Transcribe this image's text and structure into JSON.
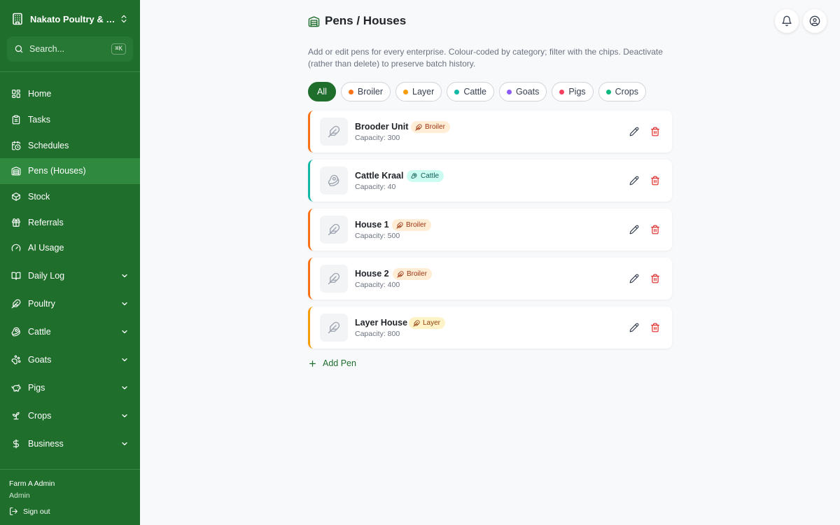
{
  "sidebar": {
    "farm_name": "Nakato Poultry & Dairy",
    "search": {
      "placeholder": "Search...",
      "shortcut": "⌘K"
    },
    "items": [
      {
        "label": "Home",
        "icon": "home-icon"
      },
      {
        "label": "Tasks",
        "icon": "clipboard-icon"
      },
      {
        "label": "Schedules",
        "icon": "calendar-clock-icon"
      },
      {
        "label": "Pens (Houses)",
        "icon": "warehouse-icon",
        "active": true
      },
      {
        "label": "Stock",
        "icon": "package-icon"
      },
      {
        "label": "Referrals",
        "icon": "gift-icon"
      },
      {
        "label": "AI Usage",
        "icon": "gauge-icon"
      }
    ],
    "groups": [
      {
        "label": "Daily Log",
        "icon": "book-icon"
      },
      {
        "label": "Poultry",
        "icon": "feather-icon"
      },
      {
        "label": "Cattle",
        "icon": "beef-icon"
      },
      {
        "label": "Goats",
        "icon": "paw-icon"
      },
      {
        "label": "Pigs",
        "icon": "piggy-icon"
      },
      {
        "label": "Crops",
        "icon": "sprout-icon"
      },
      {
        "label": "Business",
        "icon": "dollar-icon"
      }
    ],
    "user": {
      "name": "Farm A Admin",
      "role": "Admin",
      "signout_label": "Sign out"
    }
  },
  "header": {
    "title": "Pens / Houses",
    "description": "Add or edit pens for every enterprise. Colour-coded by category; filter with the chips. Deactivate (rather than delete) to preserve batch history."
  },
  "filters": [
    {
      "label": "All",
      "active": true,
      "color": ""
    },
    {
      "label": "Broiler",
      "active": false,
      "color": "#f97316"
    },
    {
      "label": "Layer",
      "active": false,
      "color": "#f59e0b"
    },
    {
      "label": "Cattle",
      "active": false,
      "color": "#14b8a6"
    },
    {
      "label": "Goats",
      "active": false,
      "color": "#8b5cf6"
    },
    {
      "label": "Pigs",
      "active": false,
      "color": "#f43f5e"
    },
    {
      "label": "Crops",
      "active": false,
      "color": "#10b981"
    }
  ],
  "pens": [
    {
      "name": "Brooder Unit",
      "capacity": "Capacity: 300",
      "category": "Broiler",
      "icon": "feather-icon",
      "accent": "#f97316",
      "badge_bg": "#ffedd5",
      "badge_fg": "#9a3412"
    },
    {
      "name": "Cattle Kraal",
      "capacity": "Capacity: 40",
      "category": "Cattle",
      "icon": "beef-icon",
      "accent": "#14b8a6",
      "badge_bg": "#ccfbf1",
      "badge_fg": "#115e59"
    },
    {
      "name": "House 1",
      "capacity": "Capacity: 500",
      "category": "Broiler",
      "icon": "feather-icon",
      "accent": "#f97316",
      "badge_bg": "#ffedd5",
      "badge_fg": "#9a3412"
    },
    {
      "name": "House 2",
      "capacity": "Capacity: 400",
      "category": "Broiler",
      "icon": "feather-icon",
      "accent": "#f97316",
      "badge_bg": "#ffedd5",
      "badge_fg": "#9a3412"
    },
    {
      "name": "Layer House",
      "capacity": "Capacity: 800",
      "category": "Layer",
      "icon": "feather-icon",
      "accent": "#f59e0b",
      "badge_bg": "#fef3c7",
      "badge_fg": "#92400e"
    }
  ],
  "add_pen_label": "Add Pen",
  "colors": {
    "brand": "#1f6e2c",
    "delete": "#dc2626"
  }
}
